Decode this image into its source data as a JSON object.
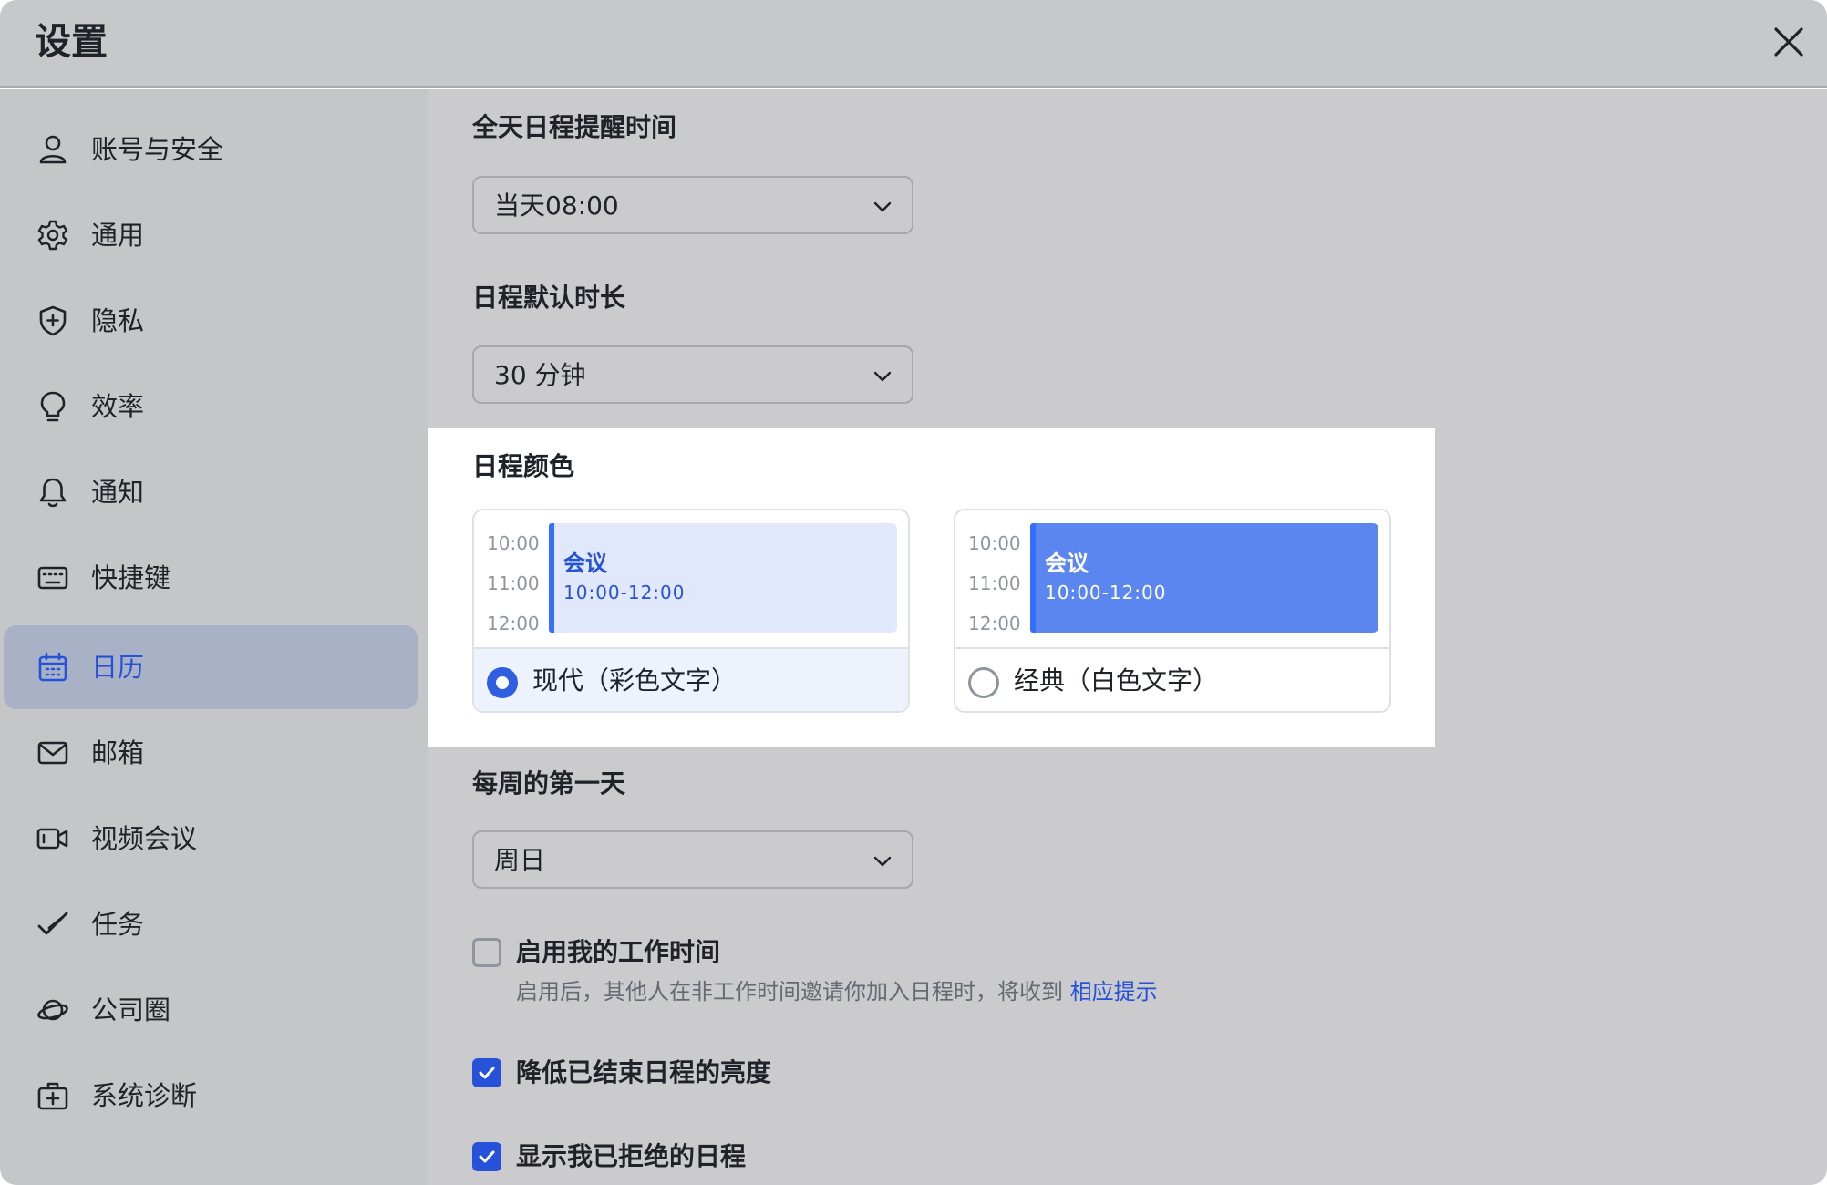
{
  "header": {
    "title": "设置"
  },
  "sidebar": {
    "items": [
      {
        "label": "账号与安全",
        "icon": "user-icon"
      },
      {
        "label": "通用",
        "icon": "gear-icon"
      },
      {
        "label": "隐私",
        "icon": "shield-icon"
      },
      {
        "label": "效率",
        "icon": "lightbulb-icon"
      },
      {
        "label": "通知",
        "icon": "bell-icon"
      },
      {
        "label": "快捷键",
        "icon": "keyboard-icon"
      },
      {
        "label": "日历",
        "icon": "calendar-icon",
        "active": true
      },
      {
        "label": "邮箱",
        "icon": "mail-icon"
      },
      {
        "label": "视频会议",
        "icon": "video-icon"
      },
      {
        "label": "任务",
        "icon": "task-check-icon"
      },
      {
        "label": "公司圈",
        "icon": "planet-icon"
      },
      {
        "label": "系统诊断",
        "icon": "medkit-icon"
      }
    ]
  },
  "calendar": {
    "allday_reminder": {
      "title": "全天日程提醒时间",
      "value": "当天08:00"
    },
    "default_duration": {
      "title": "日程默认时长",
      "value": "30 分钟"
    },
    "event_color": {
      "title": "日程颜色",
      "times": [
        "10:00",
        "11:00",
        "12:00"
      ],
      "event_title": "会议",
      "event_time": "10:00-12:00",
      "options": [
        {
          "label": "现代（彩色文字）",
          "selected": true
        },
        {
          "label": "经典（白色文字）",
          "selected": false
        }
      ]
    },
    "week_start": {
      "title": "每周的第一天",
      "value": "周日"
    },
    "working_hours": {
      "label": "启用我的工作时间",
      "checked": false,
      "hint": "启用后，其他人在非工作时间邀请你加入日程时，将收到",
      "hint_link": "相应提示"
    },
    "dim_past": {
      "label": "降低已结束日程的亮度",
      "checked": true
    },
    "show_declined": {
      "label": "显示我已拒绝的日程",
      "checked": true
    }
  },
  "colors": {
    "accent": "#2652d9",
    "sidebar_active_bg": "#a9b1c6",
    "header_bg": "#c7c8ca",
    "content_bg": "#cbcbcd",
    "modern_event_bg": "#e1e8fb",
    "classic_event_bg": "#5b86ef"
  }
}
